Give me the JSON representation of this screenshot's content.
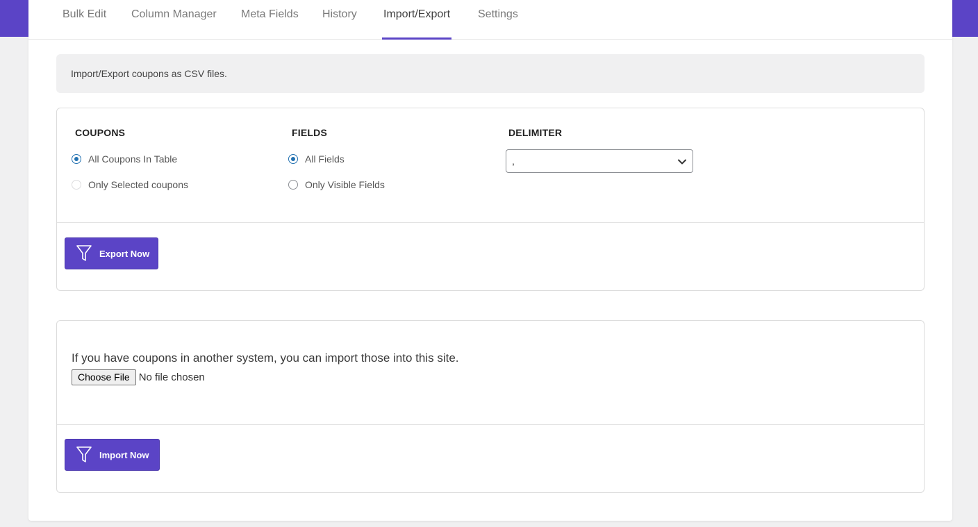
{
  "tabs": [
    {
      "label": "Bulk Edit",
      "active": false
    },
    {
      "label": "Column Manager",
      "active": false
    },
    {
      "label": "Meta Fields",
      "active": false
    },
    {
      "label": "History",
      "active": false
    },
    {
      "label": "Import/Export",
      "active": true
    },
    {
      "label": "Settings",
      "active": false
    }
  ],
  "notice": "Import/Export coupons as CSV files.",
  "export": {
    "coupons": {
      "title": "COUPONS",
      "options": [
        {
          "label": "All Coupons In Table",
          "checked": true
        },
        {
          "label": "Only Selected coupons",
          "checked": false
        }
      ]
    },
    "fields": {
      "title": "FIELDS",
      "options": [
        {
          "label": "All Fields",
          "checked": true
        },
        {
          "label": "Only Visible Fields",
          "checked": false
        }
      ]
    },
    "delimiter": {
      "title": "DELIMITER",
      "selected": ","
    },
    "button_label": "Export Now",
    "button_icon": "filter-icon"
  },
  "import": {
    "text": "If you have coupons in another system, you can import those into this site.",
    "file_button_label": "Choose File",
    "file_status": "No file chosen",
    "button_label": "Import Now",
    "button_icon": "filter-icon"
  },
  "colors": {
    "accent": "#5b44c6",
    "radio_checked": "#2271b1"
  }
}
